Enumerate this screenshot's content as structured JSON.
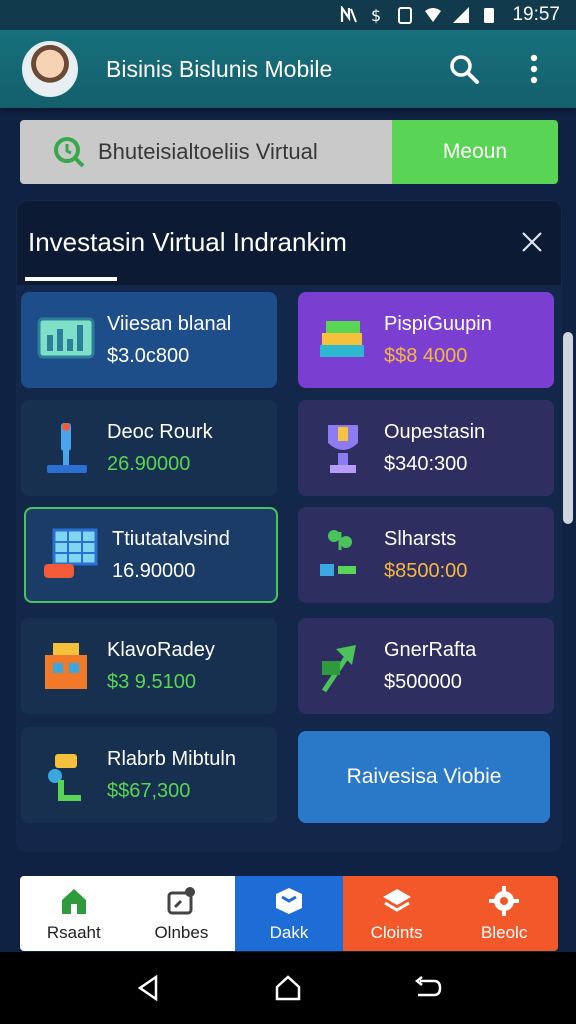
{
  "status_bar": {
    "time": "19:57"
  },
  "app_bar": {
    "title": "Bisinis Bislunis Mobile"
  },
  "search_strip": {
    "placeholder_text": "Bhuteisialtoeliis Virtual",
    "button_label": "Meoun"
  },
  "modal": {
    "title": "Investasin Virtual Indrankim",
    "tiles": [
      {
        "name": "Viiesan blanal",
        "price": "$3.0c800",
        "price_color": "#ffffff",
        "icon": "monitor-chart-icon"
      },
      {
        "name": "PispiGuupin",
        "price": "$$8 4000",
        "price_color": "#f5b642",
        "icon": "cash-stack-icon"
      },
      {
        "name": "Deoc Rourk",
        "price": "26.90000",
        "price_color": "#5ad455",
        "icon": "microscope-icon"
      },
      {
        "name": "Oupestasin",
        "price": "$340:300",
        "price_color": "#ffffff",
        "icon": "trophy-icon"
      },
      {
        "name": "Ttiutatalvsind",
        "price": "16.90000",
        "price_color": "#ffffff",
        "icon": "solar-panel-icon"
      },
      {
        "name": "Slharsts",
        "price": "$8500:00",
        "price_color": "#f5b642",
        "icon": "plant-coins-icon"
      },
      {
        "name": "KlavoRadey",
        "price": "$3 9.5100",
        "price_color": "#5ad455",
        "icon": "shop-building-icon"
      },
      {
        "name": "GnerRafta",
        "price": "$500000",
        "price_color": "#ffffff",
        "icon": "green-arrow-icon"
      },
      {
        "name": "Rlabrb Mibtuln",
        "price": "$$67,300",
        "price_color": "#5ad455",
        "icon": "robot-arm-icon"
      }
    ],
    "cta_label": "Raivesisa Viobie"
  },
  "bottom_nav": [
    {
      "label": "Rsaaht",
      "icon": "home-icon"
    },
    {
      "label": "Olnbes",
      "icon": "edit-chart-icon"
    },
    {
      "label": "Dakk",
      "icon": "box-icon"
    },
    {
      "label": "Cloints",
      "icon": "layers-icon"
    },
    {
      "label": "Bleolc",
      "icon": "gear-icon"
    }
  ],
  "colors": {
    "accent_green": "#5ad455",
    "app_bar": "#17707c",
    "nav_orange": "#f2582a",
    "nav_blue": "#1e6cd6"
  }
}
